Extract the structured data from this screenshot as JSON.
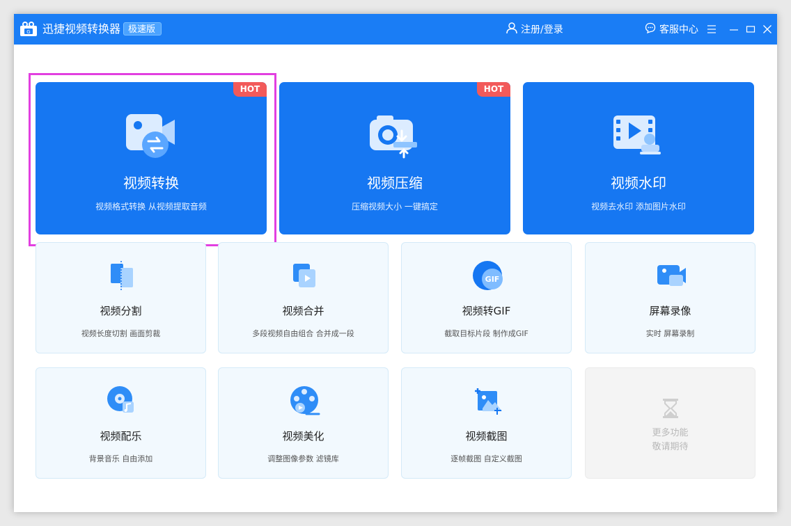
{
  "app": {
    "title": "迅捷视频转换器",
    "badge": "极速版",
    "logo_icon": "camera-logo-icon"
  },
  "titlebar": {
    "login_label": "注册/登录",
    "login_icon": "user-icon",
    "service_label": "客服中心",
    "service_icon": "chat-bubble-icon",
    "menu_icon": "hamburger-menu-icon",
    "minimize_icon": "minimize-icon",
    "maximize_icon": "maximize-icon",
    "close_icon": "close-icon"
  },
  "colors": {
    "titlebar": "#1a7df5",
    "hot_card": "#1677f2",
    "hot_badge": "#f25a5a",
    "tool_card_bg": "#f2f9fe",
    "highlight": "#e23fe0"
  },
  "hot_tools": [
    {
      "title": "视频转换",
      "subtitle": "视频格式转换 从视频提取音频",
      "badge": "HOT",
      "icon": "video-convert-icon"
    },
    {
      "title": "视频压缩",
      "subtitle": "压缩视频大小 一键搞定",
      "badge": "HOT",
      "icon": "video-compress-icon"
    },
    {
      "title": "视频水印",
      "subtitle": "视频去水印 添加图片水印",
      "badge": "",
      "icon": "video-watermark-icon"
    }
  ],
  "tools": [
    {
      "title": "视频分割",
      "subtitle": "视频长度切割 画面剪裁",
      "icon": "video-split-icon"
    },
    {
      "title": "视频合并",
      "subtitle": "多段视频自由组合 合并成一段",
      "icon": "video-merge-icon"
    },
    {
      "title": "视频转GIF",
      "subtitle": "截取目标片段 制作成GIF",
      "icon": "gif-icon"
    },
    {
      "title": "屏幕录像",
      "subtitle": "实时 屏幕录制",
      "icon": "screen-record-icon"
    },
    {
      "title": "视频配乐",
      "subtitle": "背景音乐 自由添加",
      "icon": "music-disc-icon"
    },
    {
      "title": "视频美化",
      "subtitle": "调整图像参数 滤镜库",
      "icon": "film-reel-icon"
    },
    {
      "title": "视频截图",
      "subtitle": "逐帧截图 自定义截图",
      "icon": "screenshot-icon"
    }
  ],
  "more": {
    "line1": "更多功能",
    "line2": "敬请期待",
    "icon": "hourglass-icon"
  }
}
